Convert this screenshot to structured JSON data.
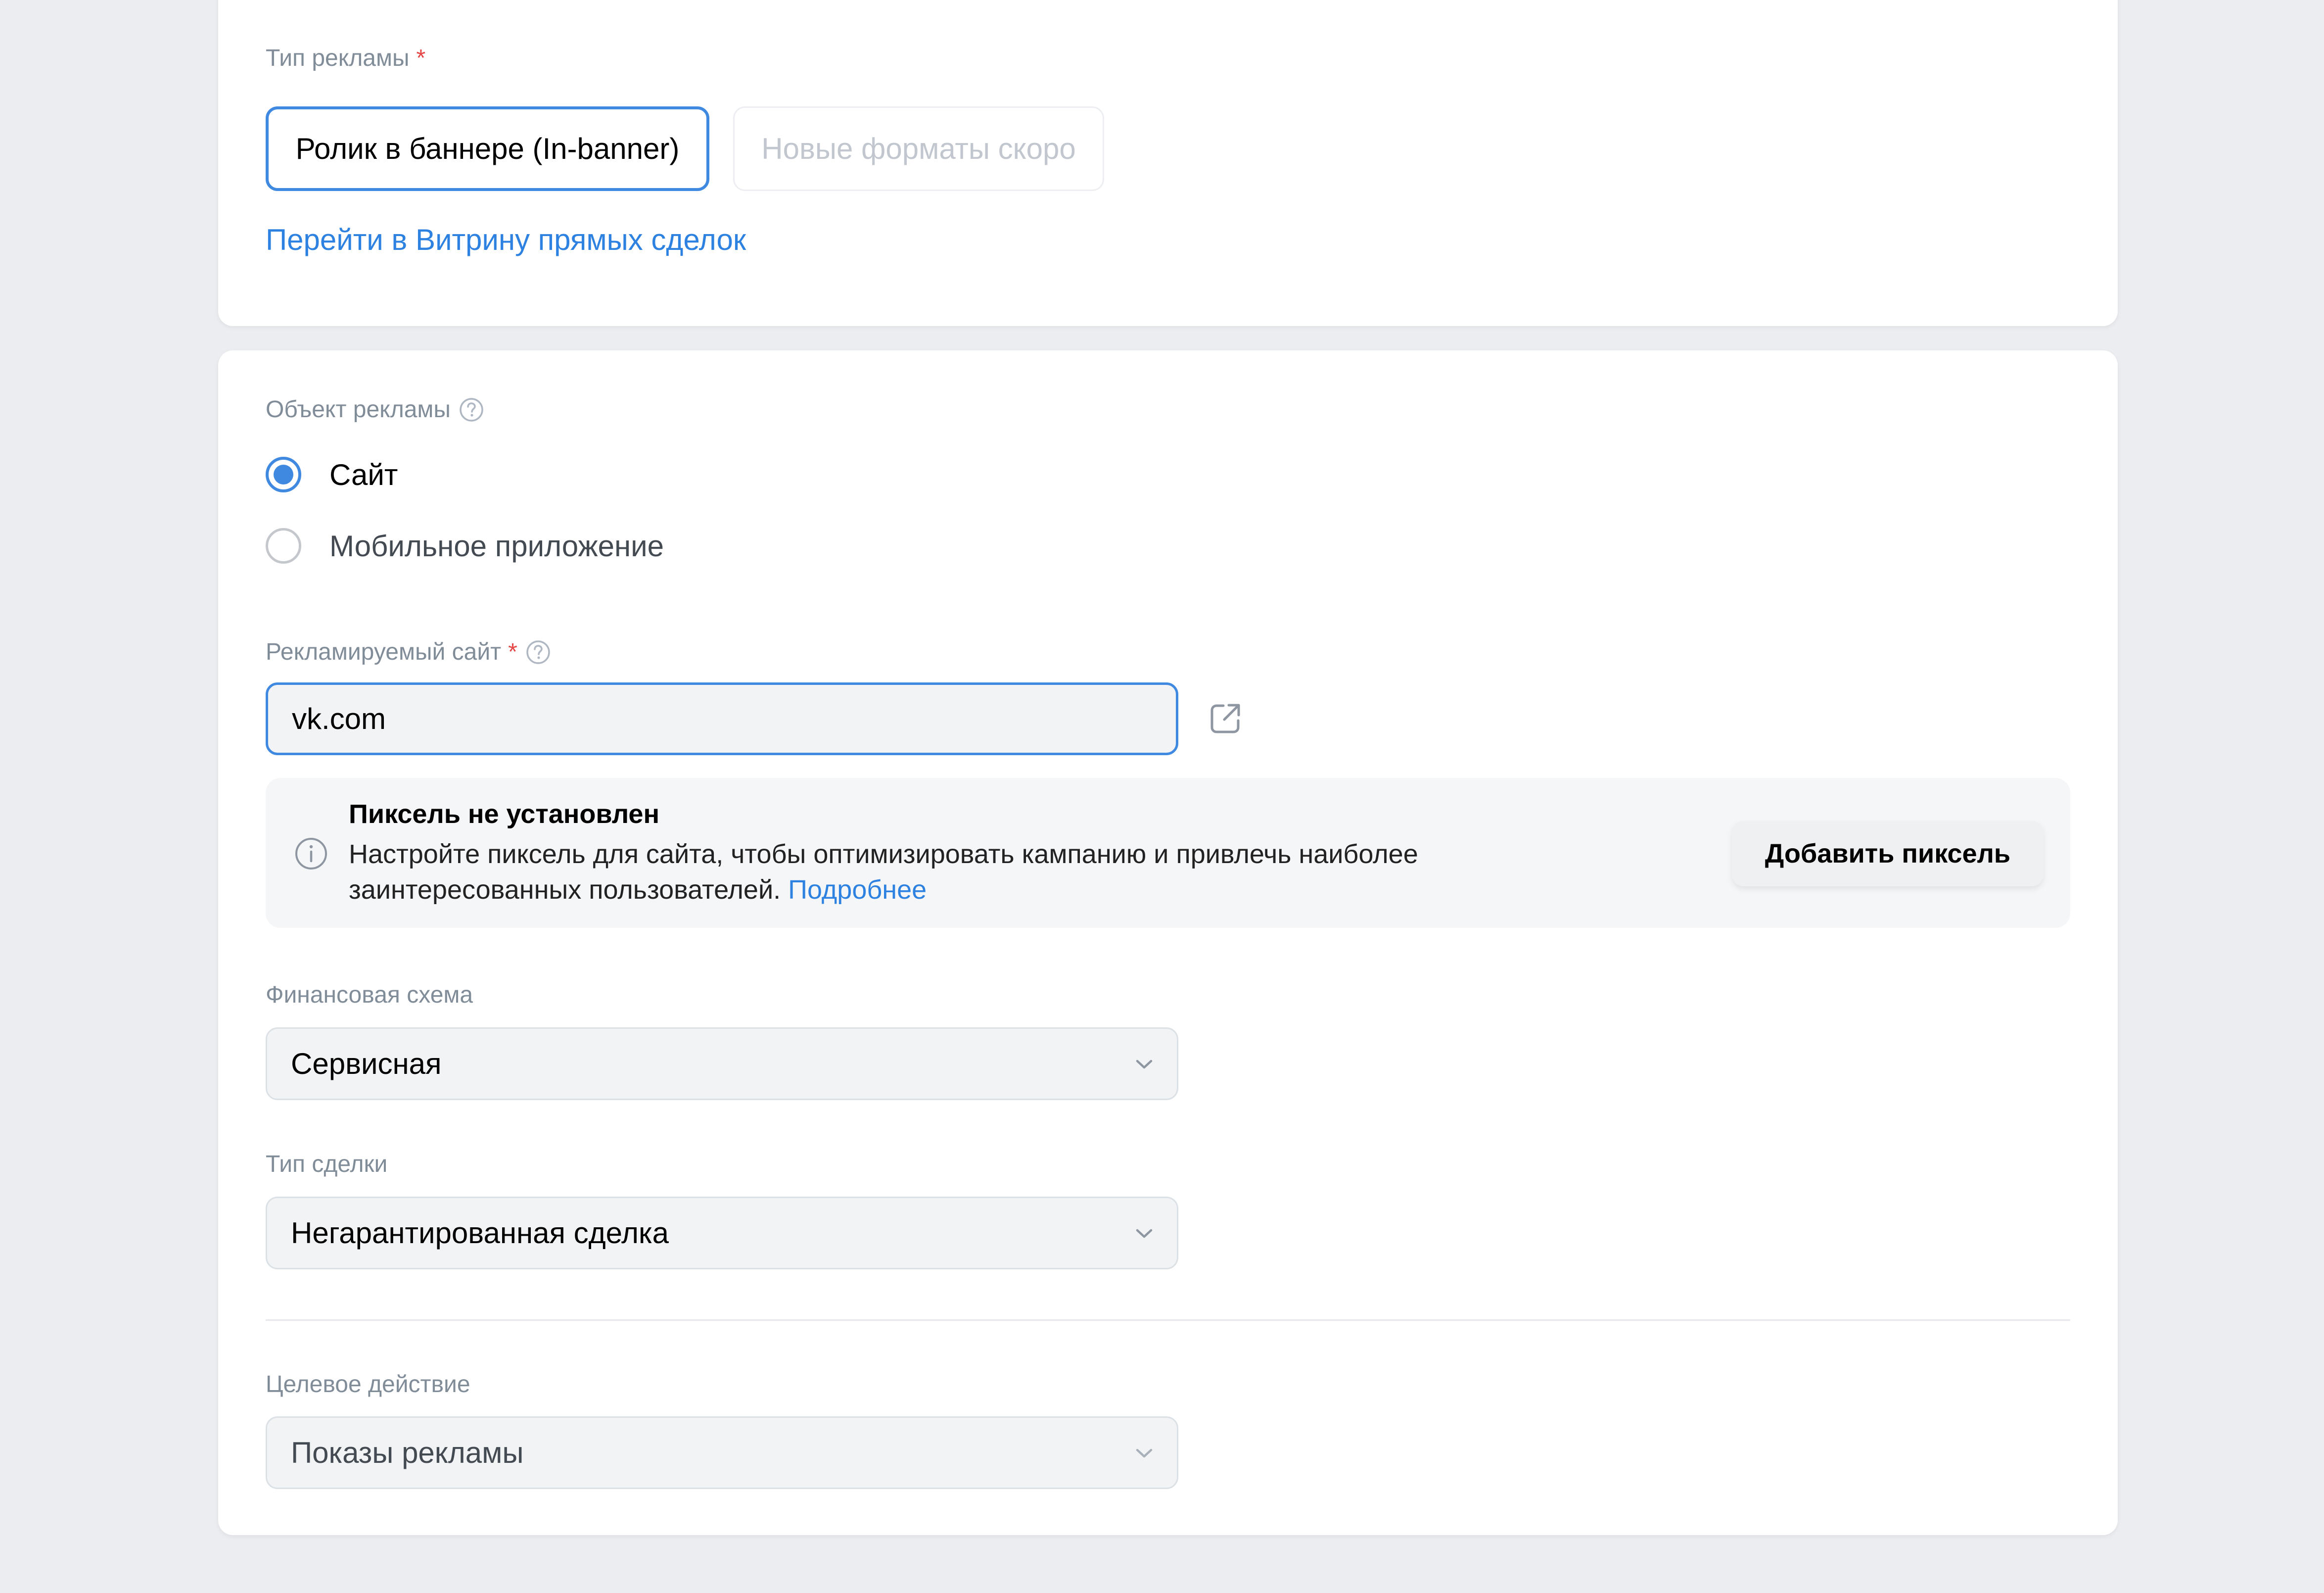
{
  "ad_type": {
    "label": "Тип рекламы",
    "required_mark": "*",
    "options": [
      {
        "label": "Ролик в баннере (In-banner)",
        "selected": true
      },
      {
        "label": "Новые форматы скоро",
        "disabled": true
      }
    ],
    "showcase_link": "Перейти в Витрину прямых сделок"
  },
  "ad_object": {
    "label": "Объект рекламы",
    "help_icon": "question-circle-icon",
    "options": [
      {
        "label": "Сайт",
        "checked": true
      },
      {
        "label": "Мобильное приложение",
        "checked": false
      }
    ]
  },
  "site": {
    "label": "Рекламируемый сайт",
    "required_mark": "*",
    "help_icon": "question-circle-icon",
    "value": "vk.com",
    "open_icon": "external-link-icon"
  },
  "pixel_banner": {
    "icon": "info-circle-icon",
    "title": "Пиксель не установлен",
    "text": "Настройте пиксель для сайта, чтобы оптимизировать кампанию и привлечь наиболее заинтересованных пользователей.",
    "link": "Подробнее",
    "button": "Добавить пиксель"
  },
  "finance_scheme": {
    "label": "Финансовая схема",
    "value": "Сервисная"
  },
  "deal_type": {
    "label": "Тип сделки",
    "value": "Негарантированная сделка"
  },
  "target_action": {
    "label": "Целевое действие",
    "value": "Показы рекламы"
  },
  "colors": {
    "accent": "#3f8ae0",
    "link": "#2d81e0",
    "required": "#e64646",
    "label": "#818c99",
    "background": "#ebedf0"
  }
}
